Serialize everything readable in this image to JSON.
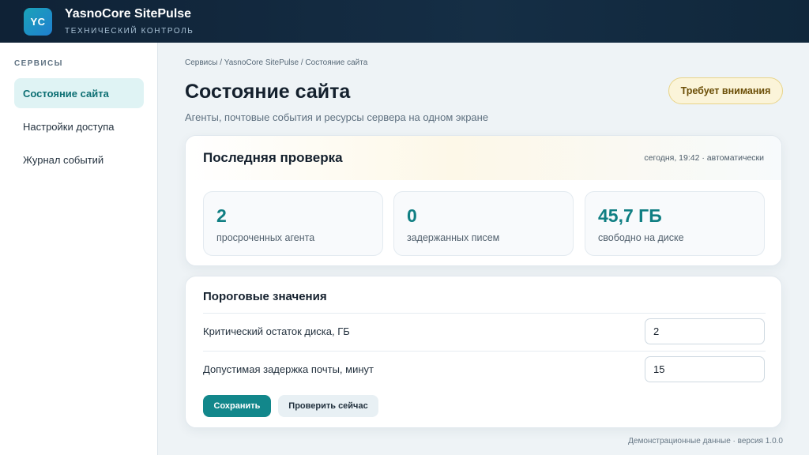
{
  "app": {
    "logo_text": "YC",
    "title": "YasnoCore SitePulse",
    "subtitle": "ТЕХНИЧЕСКИЙ КОНТРОЛЬ"
  },
  "sidebar": {
    "heading": "СЕРВИСЫ",
    "items": [
      {
        "label": "Состояние сайта",
        "active": true
      },
      {
        "label": "Настройки доступа",
        "active": false
      },
      {
        "label": "Журнал событий",
        "active": false
      }
    ]
  },
  "main": {
    "breadcrumb": "Сервисы / YasnoCore SitePulse / Состояние сайта",
    "title": "Состояние сайта",
    "description": "Агенты, почтовые события и ресурсы сервера на одном экране",
    "status_badge": "Требует внимания"
  },
  "last_check": {
    "title": "Последняя проверка",
    "meta": "сегодня, 19:42 · автоматически",
    "metrics": [
      {
        "value": "2",
        "label": "просроченных агента"
      },
      {
        "value": "0",
        "label": "задержанных писем"
      },
      {
        "value": "45,7 ГБ",
        "label": "свободно на диске"
      }
    ]
  },
  "thresholds": {
    "title": "Пороговые значения",
    "rows": [
      {
        "label": "Критический остаток диска, ГБ",
        "value": "2"
      },
      {
        "label": "Допустимая задержка почты, минут",
        "value": "15"
      }
    ],
    "save_label": "Сохранить",
    "check_label": "Проверить сейчас"
  },
  "footer": "Демонстрационные данные · версия 1.0.0",
  "colors": {
    "accent": "#12878b",
    "topbar": "#0f2236",
    "warning_badge": "#fbf4d9"
  }
}
